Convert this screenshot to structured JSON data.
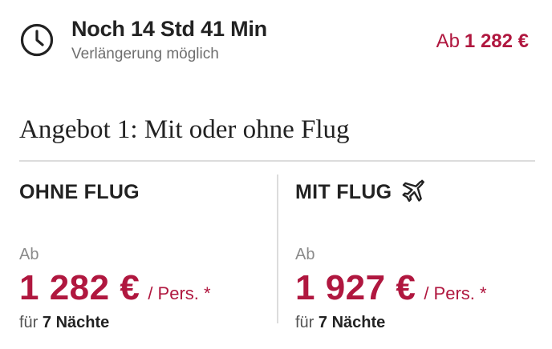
{
  "timer": {
    "icon": "clock-icon",
    "title": "Noch 14 Std 41 Min",
    "subtitle": "Verlängerung möglich"
  },
  "header_price": {
    "prefix": "Ab",
    "amount": "1 282 €"
  },
  "offer": {
    "title": "Angebot 1: Mit oder ohne Flug",
    "options": [
      {
        "heading": "OHNE FLUG",
        "from": "Ab",
        "price": "1 282 €",
        "per": "/ Pers. *",
        "nights_prefix": "für",
        "nights": "7 Nächte"
      },
      {
        "heading": "MIT FLUG",
        "icon": "airplane-icon",
        "from": "Ab",
        "price": "1 927 €",
        "per": "/ Pers. *",
        "nights_prefix": "für",
        "nights": "7 Nächte"
      }
    ]
  },
  "colors": {
    "accent": "#b0173f",
    "text": "#222222",
    "muted": "#8a8a8a",
    "divider": "#dcdcdc"
  }
}
